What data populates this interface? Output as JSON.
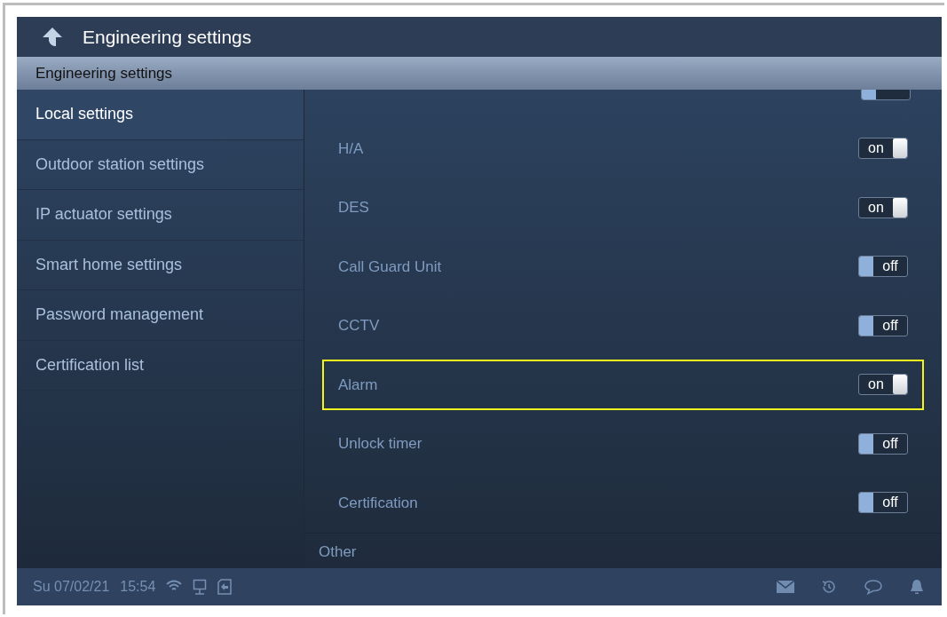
{
  "title_bar": {
    "title": "Engineering settings"
  },
  "section_header": "Engineering settings",
  "sidebar": {
    "items": [
      {
        "label": "Local settings",
        "selected": true
      },
      {
        "label": "Outdoor station settings",
        "selected": false
      },
      {
        "label": "IP actuator settings",
        "selected": false
      },
      {
        "label": "Smart home settings",
        "selected": false
      },
      {
        "label": "Password management",
        "selected": false
      },
      {
        "label": "Certification list",
        "selected": false
      }
    ]
  },
  "settings": [
    {
      "kind": "clipped",
      "on": false
    },
    {
      "kind": "toggle",
      "label": "H/A",
      "on": true,
      "toggle_text": "on",
      "highlighted": false
    },
    {
      "kind": "toggle",
      "label": "DES",
      "on": true,
      "toggle_text": "on",
      "highlighted": false
    },
    {
      "kind": "toggle",
      "label": "Call Guard Unit",
      "on": false,
      "toggle_text": "off",
      "highlighted": false
    },
    {
      "kind": "toggle",
      "label": "CCTV",
      "on": false,
      "toggle_text": "off",
      "highlighted": false
    },
    {
      "kind": "toggle",
      "label": "Alarm",
      "on": true,
      "toggle_text": "on",
      "highlighted": true
    },
    {
      "kind": "toggle",
      "label": "Unlock timer",
      "on": false,
      "toggle_text": "off",
      "highlighted": false
    },
    {
      "kind": "toggle",
      "label": "Certification",
      "on": false,
      "toggle_text": "off",
      "highlighted": false
    },
    {
      "kind": "section",
      "label": "Other"
    }
  ],
  "status_bar": {
    "date": "Su 07/02/21",
    "time": "15:54"
  }
}
